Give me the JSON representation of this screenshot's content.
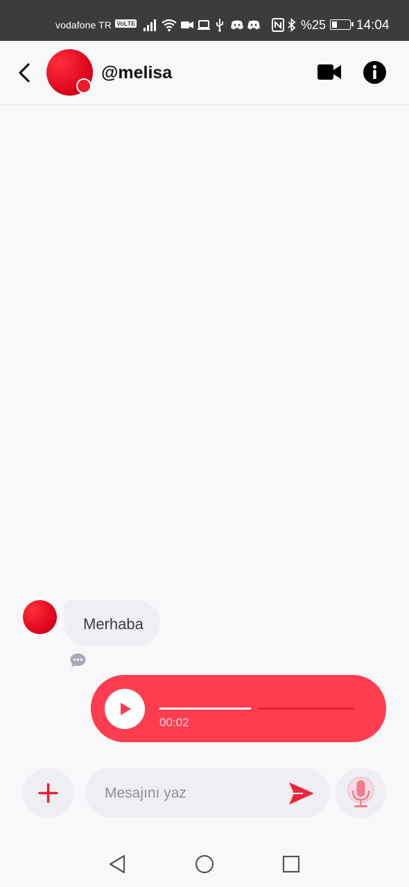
{
  "status_bar": {
    "carrier": "vodafone TR",
    "volte": "VoLTE",
    "battery_percent": "%25",
    "time": "14:04",
    "icons": [
      "signal-icon",
      "wifi-icon",
      "video-record-icon",
      "cast-icon",
      "usb-icon",
      "discord-icon",
      "discord-icon",
      "nfc-icon",
      "bluetooth-icon",
      "battery-charging-icon"
    ]
  },
  "header": {
    "username": "@melisa",
    "online": true
  },
  "messages": [
    {
      "direction": "incoming",
      "type": "text",
      "text": "Merhaba"
    },
    {
      "direction": "outgoing",
      "type": "voice",
      "duration": "00:02",
      "progress": 0.47
    }
  ],
  "composer": {
    "placeholder": "Mesajını yaz"
  },
  "colors": {
    "accent": "#ff3d50",
    "status_bar": "#3c3c3c",
    "background": "#f8f7fa",
    "bubble_in": "#efeef2"
  }
}
